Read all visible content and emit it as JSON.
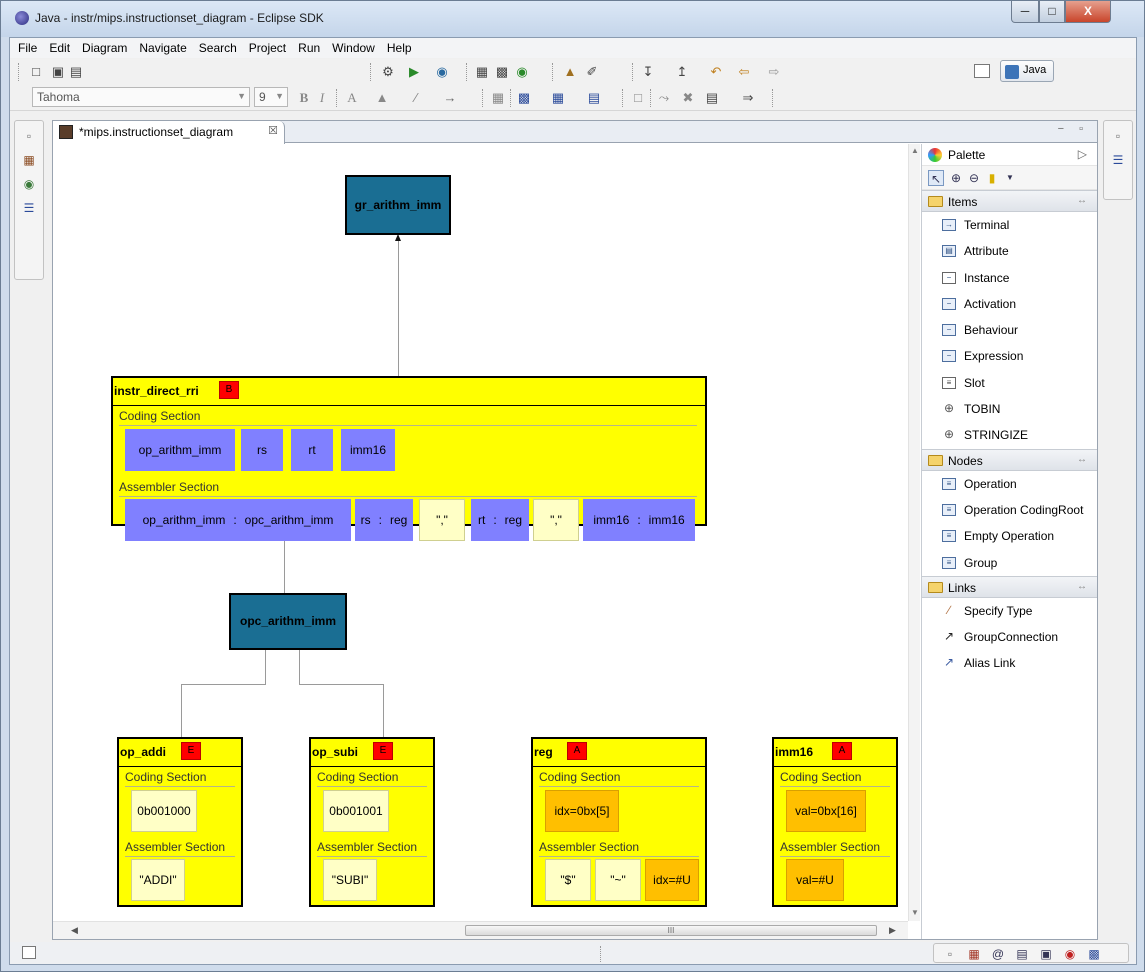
{
  "window": {
    "title": "Java - instr/mips.instructionset_diagram - Eclipse SDK",
    "minimize_glyph": "─",
    "maximize_glyph": "□",
    "close_glyph": "X"
  },
  "menu": [
    "File",
    "Edit",
    "Diagram",
    "Navigate",
    "Search",
    "Project",
    "Run",
    "Window",
    "Help"
  ],
  "toolbar": {
    "font_name": "Tahoma",
    "font_size": "9",
    "bold_label": "B",
    "italic_label": "I",
    "font_color_label": "A",
    "perspective_label": "Java"
  },
  "editor": {
    "tab_label": "*mips.instructionset_diagram",
    "tab_close": "☒",
    "view_controls": "− ▫"
  },
  "diagram": {
    "groups": {
      "gr_arithm_imm": "gr_arithm_imm",
      "opc_arithm_imm": "opc_arithm_imm"
    },
    "instr": {
      "title": "instr_direct_rri",
      "badge": "B",
      "coding_title": "Coding Section",
      "coding_fields": [
        "op_arithm_imm",
        "rs",
        "rt",
        "imm16"
      ],
      "assembler_title": "Assembler Section",
      "asm_fields": [
        {
          "a": "op_arithm_imm",
          "sep": ":",
          "b": "opc_arithm_imm"
        },
        {
          "a": "rs",
          "sep": ":",
          "b": "reg"
        },
        {
          "text": "\",\""
        },
        {
          "a": "rt",
          "sep": ":",
          "b": "reg"
        },
        {
          "text": "\",\""
        },
        {
          "a": "imm16",
          "sep": ":",
          "b": "imm16"
        }
      ]
    },
    "op_addi": {
      "title": "op_addi",
      "badge": "E",
      "coding_title": "Coding Section",
      "coding": "0b001000",
      "assembler_title": "Assembler Section",
      "asm": "\"ADDI\""
    },
    "op_subi": {
      "title": "op_subi",
      "badge": "E",
      "coding_title": "Coding Section",
      "coding": "0b001001",
      "assembler_title": "Assembler Section",
      "asm": "\"SUBI\""
    },
    "reg": {
      "title": "reg",
      "badge": "A",
      "coding_title": "Coding Section",
      "coding": "idx=0bx[5]",
      "assembler_title": "Assembler Section",
      "asm": [
        "\"$\"",
        "\"~\"",
        "idx=#U"
      ]
    },
    "imm16": {
      "title": "imm16",
      "badge": "A",
      "coding_title": "Coding Section",
      "coding": "val=0bx[16]",
      "assembler_title": "Assembler Section",
      "asm": "val=#U"
    }
  },
  "palette": {
    "title": "Palette",
    "more_glyph": "▷",
    "drawers": {
      "items": {
        "label": "Items",
        "entries": [
          "Terminal",
          "Attribute",
          "Instance",
          "Activation",
          "Behaviour",
          "Expression",
          "Slot",
          "TOBIN",
          "STRINGIZE"
        ]
      },
      "nodes": {
        "label": "Nodes",
        "entries": [
          "Operation",
          "Operation CodingRoot",
          "Empty Operation",
          "Group"
        ]
      },
      "links": {
        "label": "Links",
        "entries": [
          "Specify Type",
          "GroupConnection",
          "Alias Link"
        ]
      }
    }
  },
  "scroll": {
    "thumb_grip": "III"
  }
}
